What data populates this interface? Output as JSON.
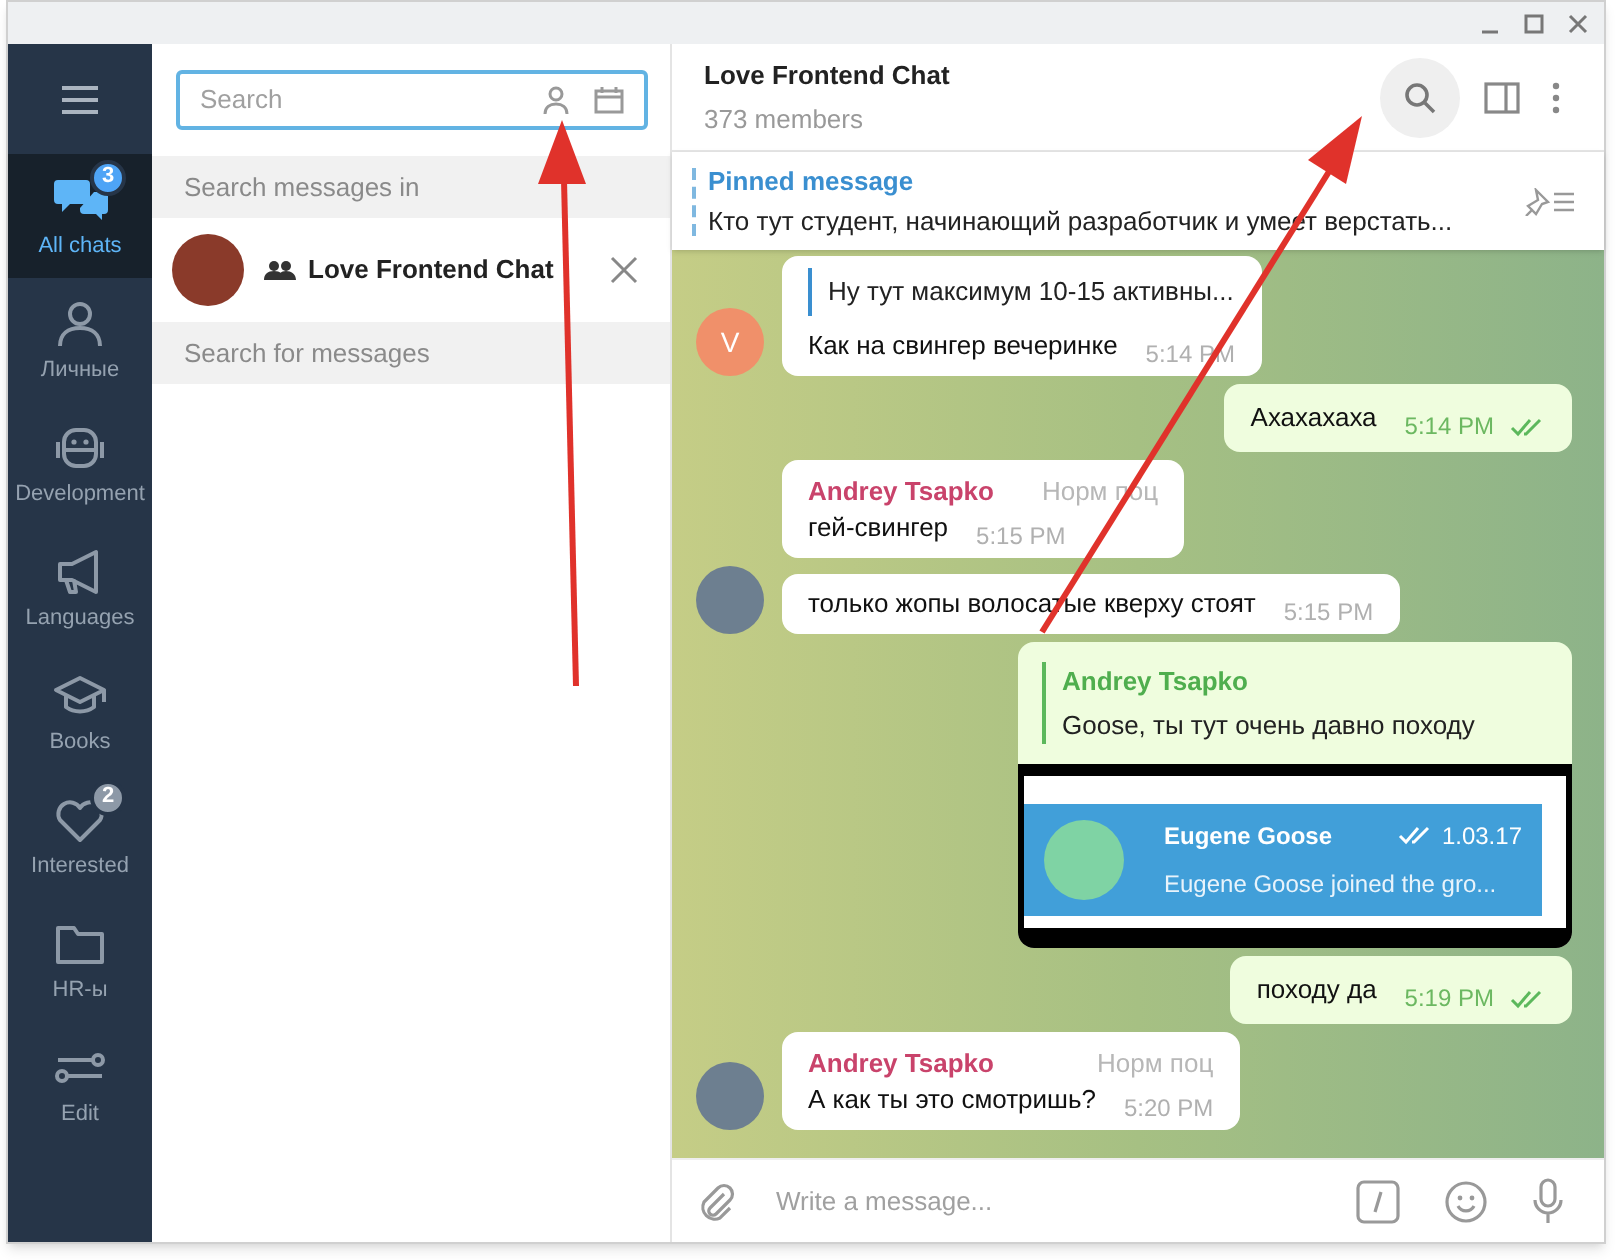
{
  "folders": [
    {
      "kind": "all",
      "label": "All chats",
      "badge": "3",
      "selected": true
    },
    {
      "kind": "person",
      "label": "Личные",
      "selected": false
    },
    {
      "kind": "robot",
      "label": "Development",
      "selected": false
    },
    {
      "kind": "megaphone",
      "label": "Languages",
      "selected": false
    },
    {
      "kind": "cap",
      "label": "Books",
      "selected": false
    },
    {
      "kind": "heart",
      "label": "Interested",
      "badge": "2",
      "selected": false
    },
    {
      "kind": "folder",
      "label": "HR-ы",
      "selected": false
    },
    {
      "kind": "edit",
      "label": "Edit",
      "selected": false
    }
  ],
  "search": {
    "placeholder": "Search"
  },
  "search_panel": {
    "heading": "Search messages in",
    "chat": {
      "name": "Love Frontend Chat"
    },
    "footer": "Search for messages"
  },
  "chat": {
    "title": "Love Frontend Chat",
    "members": "373 members",
    "pinned": {
      "label": "Pinned message",
      "text": "Кто тут студент, начинающий разработчик и умеет верстать..."
    },
    "messages": [
      {
        "kind": "incoming",
        "avatar_letter": "V",
        "reply": {
          "text": "Ну тут максимум 10-15 активны..."
        },
        "text": "Как на свингер вечеринке",
        "time": "5:14 PM"
      },
      {
        "kind": "outgoing",
        "text": "Ахахахаха",
        "time": "5:14 PM",
        "read": true
      },
      {
        "kind": "incoming",
        "avatar_photo": false,
        "sender": "Andrey Tsapko",
        "rank": "Норм поц",
        "text": "гей-свингер",
        "time": "5:15 PM"
      },
      {
        "kind": "incoming",
        "avatar_photo": true,
        "text": "только жопы волосатые кверху стоят",
        "time": "5:15 PM"
      },
      {
        "kind": "outgoing-image",
        "reply": {
          "sender": "Andrey Tsapko",
          "text": "Goose, ты тут очень давно походу"
        },
        "embed": {
          "name": "Eugene Goose",
          "date": "1.03.17",
          "text": "Eugene Goose joined the gro...",
          "read": true
        }
      },
      {
        "kind": "outgoing",
        "text": "походу да",
        "time": "5:19 PM",
        "read": true
      },
      {
        "kind": "incoming",
        "avatar_photo": true,
        "sender": "Andrey Tsapko",
        "rank": "Норм поц",
        "text": "А как ты это смотришь?",
        "time": "5:20 PM"
      }
    ],
    "composer": {
      "placeholder": "Write a message..."
    }
  }
}
